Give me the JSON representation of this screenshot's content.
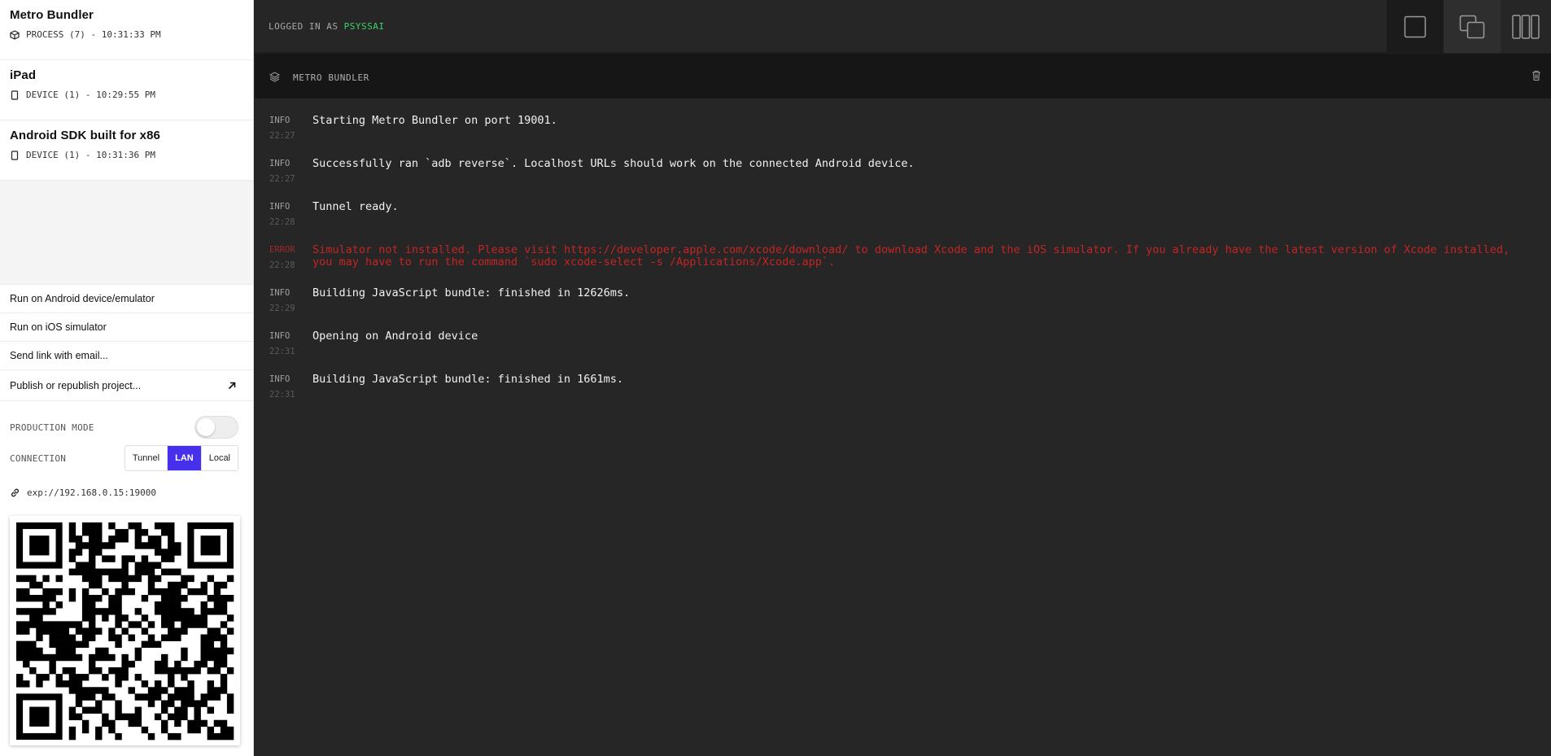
{
  "sidebar": {
    "sources": [
      {
        "name": "Metro Bundler",
        "meta": "PROCESS (7) - 10:31:33 PM",
        "icon": "cube-icon"
      },
      {
        "name": "iPad",
        "meta": "DEVICE (1) - 10:29:55 PM",
        "icon": "device-icon"
      },
      {
        "name": "Android SDK built for x86",
        "meta": "DEVICE (1) - 10:31:36 PM",
        "icon": "device-icon"
      }
    ],
    "actions": [
      {
        "label": "Run on Android device/emulator"
      },
      {
        "label": "Run on iOS simulator"
      },
      {
        "label": "Send link with email..."
      },
      {
        "label": "Publish or republish project..."
      }
    ],
    "production_mode_label": "PRODUCTION MODE",
    "production_mode_on": false,
    "connection_label": "CONNECTION",
    "connection_options": [
      "Tunnel",
      "LAN",
      "Local"
    ],
    "connection_selected": "LAN",
    "url": "exp://192.168.0.15:19000",
    "accent_color": "#4630eb"
  },
  "topbar": {
    "logged_in_prefix": "LOGGED IN AS",
    "username": "PSYSSAI",
    "layout_buttons": [
      "single-panel-icon",
      "overlap-panels-icon",
      "columns-icon"
    ]
  },
  "panel": {
    "title": "METRO BUNDLER"
  },
  "logs": [
    {
      "level": "INFO",
      "time": "22:27",
      "message": "Starting Metro Bundler on port 19001."
    },
    {
      "level": "INFO",
      "time": "22:27",
      "message": "Successfully ran `adb reverse`. Localhost URLs should work on the connected Android device."
    },
    {
      "level": "INFO",
      "time": "22:28",
      "message": "Tunnel ready."
    },
    {
      "level": "ERROR",
      "time": "22:28",
      "message": "Simulator not installed. Please visit https://developer.apple.com/xcode/download/ to download Xcode and the iOS simulator. If you already have the latest version of Xcode installed, you may have to run the command `sudo xcode-select -s /Applications/Xcode.app`."
    },
    {
      "level": "INFO",
      "time": "22:29",
      "message": "Building JavaScript bundle: finished in 12626ms."
    },
    {
      "level": "INFO",
      "time": "22:31",
      "message": "Opening on Android device"
    },
    {
      "level": "INFO",
      "time": "22:31",
      "message": "Building JavaScript bundle: finished in 1661ms."
    }
  ]
}
